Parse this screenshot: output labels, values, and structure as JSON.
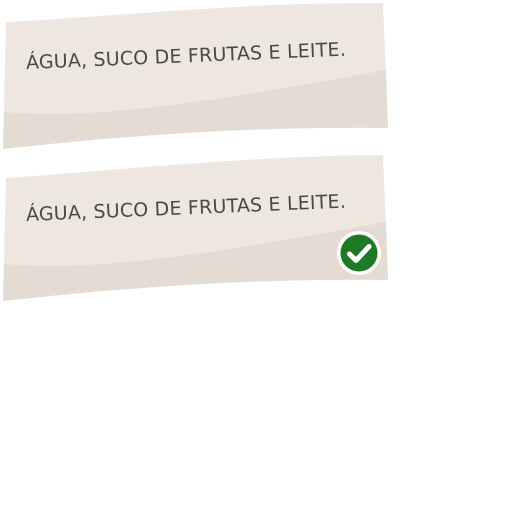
{
  "answers": [
    {
      "text": "ÁGUA, SUCO DE FRUTAS E LEITE.",
      "state": "default"
    },
    {
      "text": "ÁGUA, SUCO DE FRUTAS E LEITE.",
      "state": "correct"
    }
  ],
  "colors": {
    "paper_light": "#ede7e0",
    "paper_shade": "#e4dcd2",
    "text": "#4a4946",
    "check_green": "#1f7a25",
    "check_ring": "#ffffff"
  },
  "icons": {
    "correct": "check-icon"
  }
}
